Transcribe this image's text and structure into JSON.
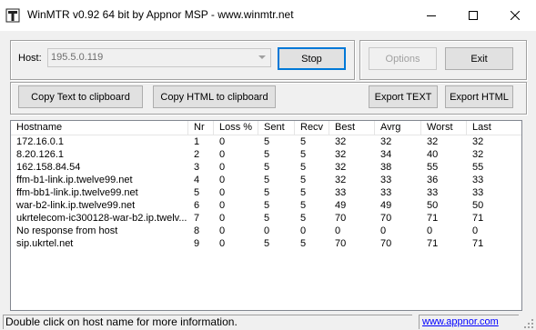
{
  "window": {
    "title": "WinMTR v0.92 64 bit by Appnor MSP - www.winmtr.net",
    "minimize_glyph": "—",
    "maximize_glyph": "☐",
    "close_glyph": "✕"
  },
  "host": {
    "label": "Host:",
    "value": "195.5.0.119"
  },
  "buttons": {
    "stop": "Stop",
    "options": "Options",
    "exit": "Exit",
    "copy_text": "Copy Text to clipboard",
    "copy_html": "Copy HTML to clipboard",
    "export_text": "Export TEXT",
    "export_html": "Export HTML"
  },
  "table": {
    "columns": [
      "Hostname",
      "Nr",
      "Loss %",
      "Sent",
      "Recv",
      "Best",
      "Avrg",
      "Worst",
      "Last"
    ],
    "rows": [
      [
        "172.16.0.1",
        "1",
        "0",
        "5",
        "5",
        "32",
        "32",
        "32",
        "32"
      ],
      [
        "8.20.126.1",
        "2",
        "0",
        "5",
        "5",
        "32",
        "34",
        "40",
        "32"
      ],
      [
        "162.158.84.54",
        "3",
        "0",
        "5",
        "5",
        "32",
        "38",
        "55",
        "55"
      ],
      [
        "ffm-b1-link.ip.twelve99.net",
        "4",
        "0",
        "5",
        "5",
        "32",
        "33",
        "36",
        "33"
      ],
      [
        "ffm-bb1-link.ip.twelve99.net",
        "5",
        "0",
        "5",
        "5",
        "33",
        "33",
        "33",
        "33"
      ],
      [
        "war-b2-link.ip.twelve99.net",
        "6",
        "0",
        "5",
        "5",
        "49",
        "49",
        "50",
        "50"
      ],
      [
        "ukrtelecom-ic300128-war-b2.ip.twelv...",
        "7",
        "0",
        "5",
        "5",
        "70",
        "70",
        "71",
        "71"
      ],
      [
        "No response from host",
        "8",
        "0",
        "0",
        "0",
        "0",
        "0",
        "0",
        "0"
      ],
      [
        "sip.ukrtel.net",
        "9",
        "0",
        "5",
        "5",
        "70",
        "70",
        "71",
        "71"
      ]
    ]
  },
  "status": {
    "message": "Double click on host name for more information.",
    "link": "www.appnor.com"
  }
}
